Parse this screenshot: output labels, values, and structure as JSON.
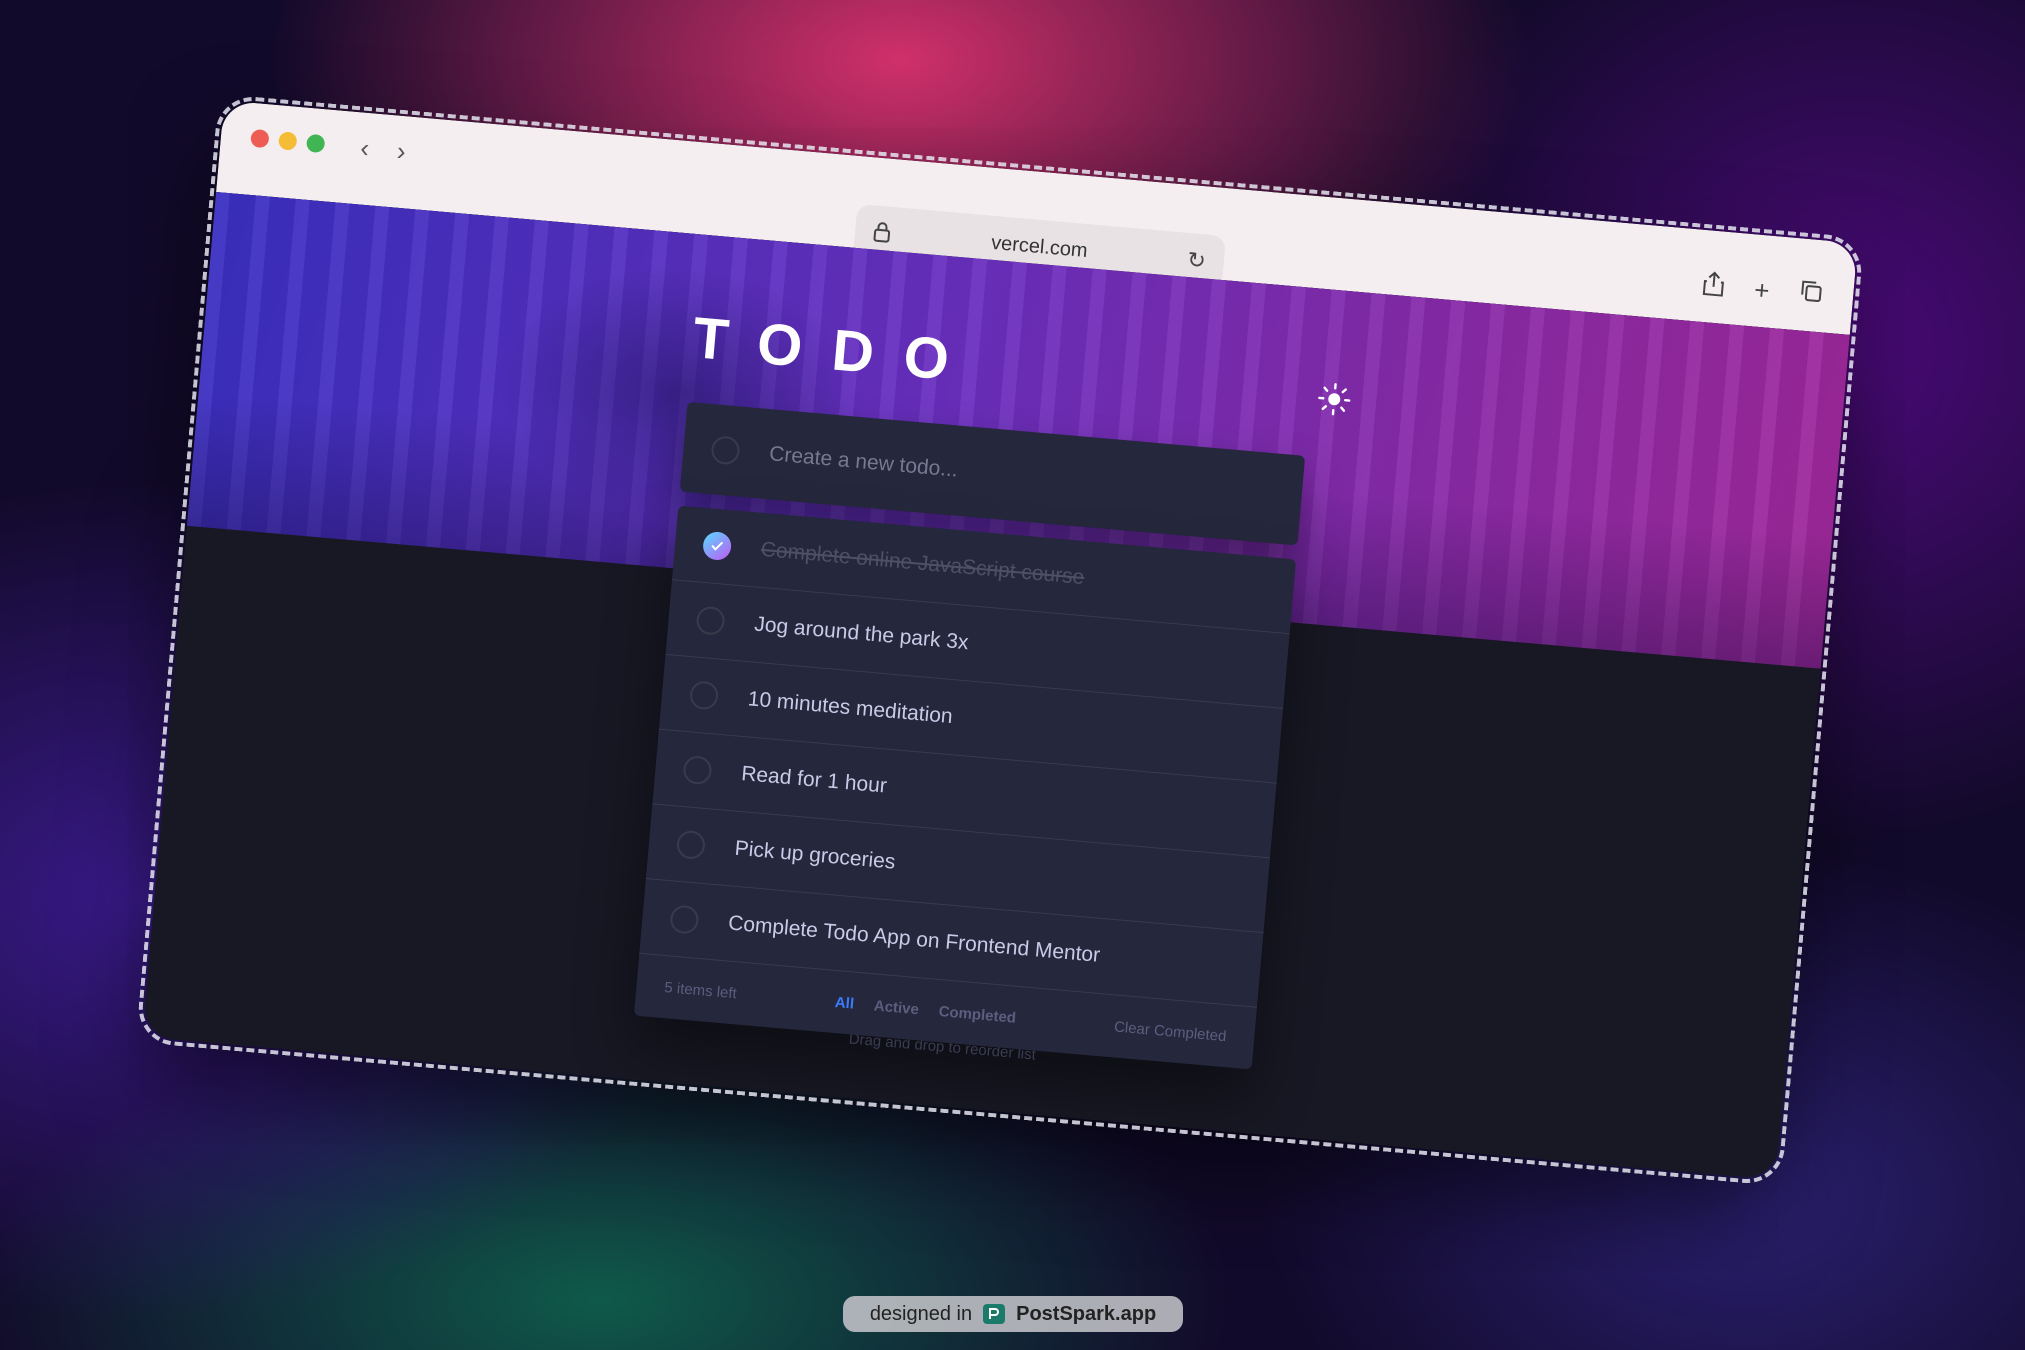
{
  "browser": {
    "url": "vercel.com",
    "colors": {
      "close": "#ee5d54",
      "minimize": "#f5bd35",
      "zoom": "#41b553"
    },
    "icons": [
      "back-arrow-icon",
      "forward-arrow-icon",
      "lock-icon",
      "reload-icon",
      "share-icon",
      "new-tab-icon",
      "tabs-icon"
    ]
  },
  "app": {
    "title": "TODO",
    "theme_toggle_icon": "sun-icon",
    "new_todo_placeholder": "Create a new todo...",
    "todos": [
      {
        "text": "Complete online JavaScript course",
        "completed": true
      },
      {
        "text": "Jog around the park 3x",
        "completed": false
      },
      {
        "text": "10 minutes meditation",
        "completed": false
      },
      {
        "text": "Read for 1 hour",
        "completed": false
      },
      {
        "text": "Pick up groceries",
        "completed": false
      },
      {
        "text": "Complete Todo App on Frontend Mentor",
        "completed": false
      }
    ],
    "items_left": "5 items left",
    "filters": {
      "all": "All",
      "active": "Active",
      "completed": "Completed"
    },
    "clear_completed": "Clear Completed",
    "hint": "Drag and drop to reorder list",
    "accent_color": "#3a7cfd"
  },
  "badge": {
    "prefix": "designed in",
    "brand": "PostSpark.app"
  }
}
